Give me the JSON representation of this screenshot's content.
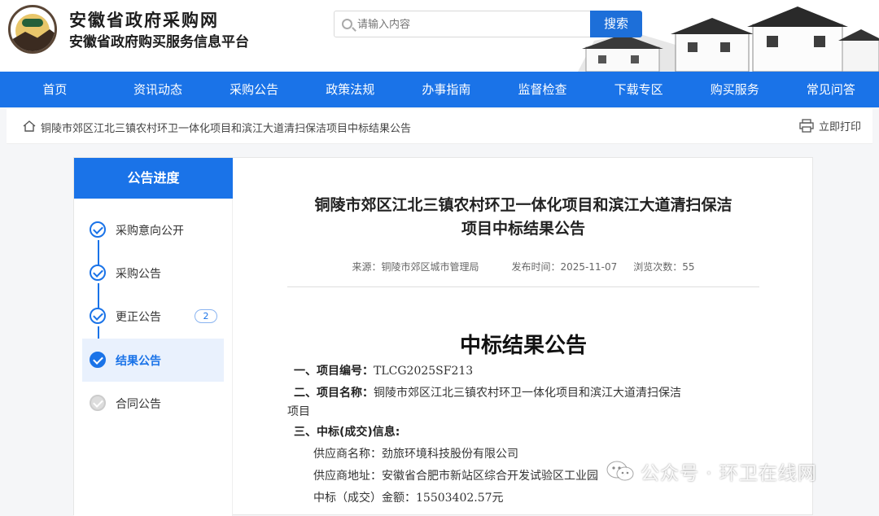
{
  "header": {
    "site_title": "安徽省政府采购网",
    "site_subtitle": "安徽省政府购买服务信息平台",
    "search_placeholder": "请输入内容",
    "search_button": "搜索"
  },
  "nav": [
    "首页",
    "资讯动态",
    "采购公告",
    "政策法规",
    "办事指南",
    "监督检查",
    "下载专区",
    "购买服务",
    "常见问答"
  ],
  "breadcrumb": {
    "text": "铜陵市郊区江北三镇农村环卫一体化项目和滨江大道清扫保洁项目中标结果公告",
    "print_label": "立即打印"
  },
  "sidebar": {
    "title": "公告进度",
    "steps": [
      {
        "label": "采购意向公开",
        "state": "done"
      },
      {
        "label": "采购公告",
        "state": "done"
      },
      {
        "label": "更正公告",
        "state": "done",
        "badge": "2"
      },
      {
        "label": "结果公告",
        "state": "active"
      },
      {
        "label": "合同公告",
        "state": "pending"
      }
    ]
  },
  "article": {
    "title_line1": "铜陵市郊区江北三镇农村环卫一体化项目和滨江大道清扫保洁",
    "title_line2": "项目中标结果公告",
    "source": "来源：铜陵市郊区城市管理局",
    "publish_time": "发布时间：2025-11-07",
    "views": "浏览次数：55",
    "heading": "中标结果公告",
    "sec1_label": "一、项目编号：",
    "sec1_value": "TLCG2025SF213",
    "sec2_label": "二、项目名称：",
    "sec2_value": "铜陵市郊区江北三镇农村环卫一体化项目和滨江大道清扫保洁",
    "sec2_value_cont": "项目",
    "sec3_label": "三、中标(成交)信息:",
    "supplier_name": "供应商名称：劲旅环境科技股份有限公司",
    "supplier_address": "供应商地址：安徽省合肥市新站区综合开发试验区工业园",
    "amount": "中标（成交）金额：15503402.57元"
  },
  "watermark": "公众号 · 环卫在线网"
}
